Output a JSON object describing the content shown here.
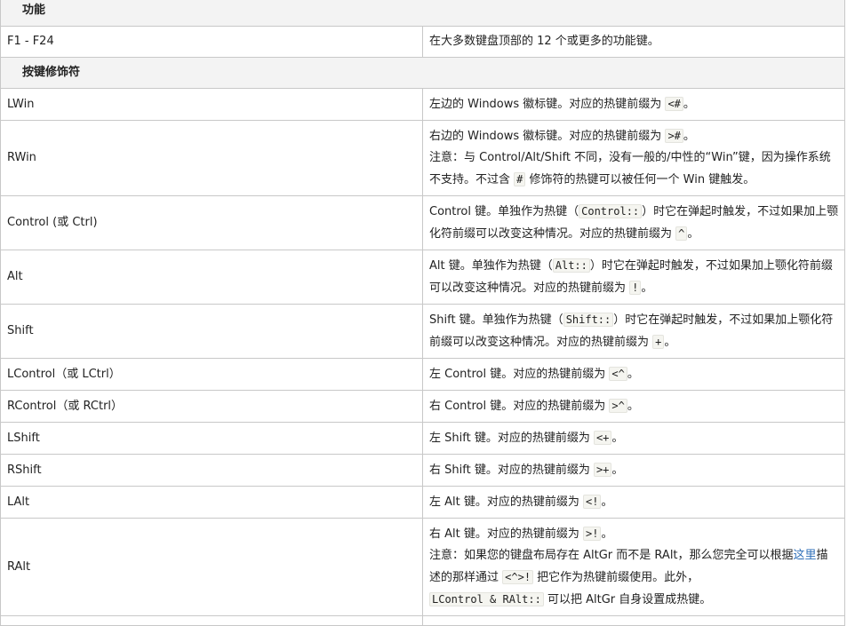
{
  "section_function": "功能",
  "section_modifiers": "按键修饰符",
  "rows": {
    "f1_f24": {
      "key": "F1 - F24",
      "desc": "在大多数键盘顶部的 12 个或更多的功能键。"
    },
    "lwin": {
      "key": "LWin",
      "desc_a": "左边的 Windows 徽标键。对应的热键前缀为 ",
      "code1": "<#",
      "desc_b": "。"
    },
    "rwin": {
      "key": "RWin",
      "desc_a": "右边的 Windows 徽标键。对应的热键前缀为 ",
      "code1": ">#",
      "desc_b": "。",
      "note_a": "注意：与 Control/Alt/Shift 不同，没有一般的/中性的“Win”键，因为操作系统不支持。不过含 ",
      "code2": "#",
      "note_b": " 修饰符的热键可以被任何一个 Win 键触发。"
    },
    "control": {
      "key": "Control (或 Ctrl)",
      "desc_a": "Control 键。单独作为热键（",
      "code1": "Control::",
      "desc_b": "）时它在弹起时触发，不过如果加上颚化符前缀可以改变这种情况。对应的热键前缀为 ",
      "code2": "^",
      "desc_c": "。"
    },
    "alt": {
      "key": "Alt",
      "desc_a": "Alt 键。单独作为热键（",
      "code1": "Alt::",
      "desc_b": "）时它在弹起时触发，不过如果加上颚化符前缀可以改变这种情况。对应的热键前缀为 ",
      "code2": "!",
      "desc_c": "。"
    },
    "shift": {
      "key": "Shift",
      "desc_a": "Shift 键。单独作为热键（",
      "code1": "Shift::",
      "desc_b": "）时它在弹起时触发，不过如果加上颚化符前缀可以改变这种情况。对应的热键前缀为 ",
      "code2": "+",
      "desc_c": "。"
    },
    "lcontrol": {
      "key": "LControl（或 LCtrl）",
      "desc_a": "左 Control 键。对应的热键前缀为 ",
      "code1": "<^",
      "desc_b": "。"
    },
    "rcontrol": {
      "key": "RControl（或 RCtrl）",
      "desc_a": "右 Control 键。对应的热键前缀为 ",
      "code1": ">^",
      "desc_b": "。"
    },
    "lshift": {
      "key": "LShift",
      "desc_a": "左 Shift 键。对应的热键前缀为 ",
      "code1": "<+",
      "desc_b": "。"
    },
    "rshift": {
      "key": "RShift",
      "desc_a": "右 Shift 键。对应的热键前缀为 ",
      "code1": ">+",
      "desc_b": "。"
    },
    "lalt": {
      "key": "LAlt",
      "desc_a": "左 Alt 键。对应的热键前缀为 ",
      "code1": "<!",
      "desc_b": "。"
    },
    "ralt": {
      "key": "RAlt",
      "desc_a": "右 Alt 键。对应的热键前缀为 ",
      "code1": ">!",
      "desc_b": "。",
      "note_a": "注意：如果您的键盘布局存在 AltGr 而不是 RAlt，那么您完全可以根据",
      "link": "这里",
      "note_b": "描述的那样通过 ",
      "code2": "<^>!",
      "note_c": " 把它作为热键前缀使用。此外，",
      "code3": "LControl & RAlt::",
      "note_d": " 可以把 AltGr 自身设置成热键。"
    }
  }
}
